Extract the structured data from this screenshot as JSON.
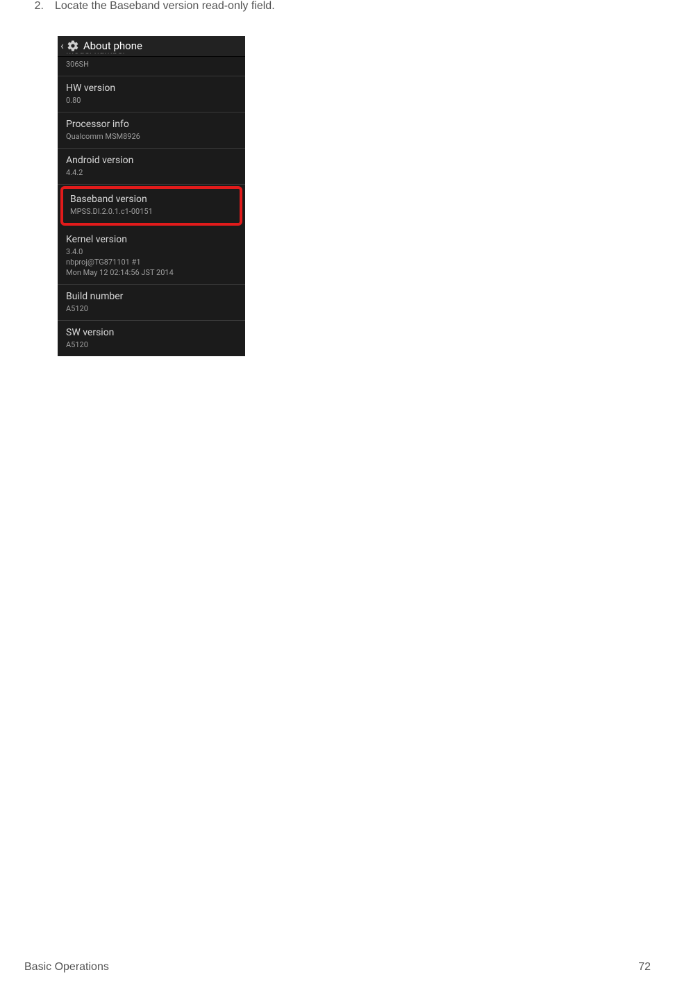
{
  "instruction": {
    "number": "2.",
    "text": "Locate the Baseband version read-only field."
  },
  "phone": {
    "header_title": "About phone",
    "items": {
      "model_number": {
        "label": "Model number",
        "value": "306SH"
      },
      "hw_version": {
        "label": "HW version",
        "value": "0.80"
      },
      "processor_info": {
        "label": "Processor info",
        "value": "Qualcomm MSM8926"
      },
      "android_version": {
        "label": "Android version",
        "value": "4.4.2"
      },
      "baseband_version": {
        "label": "Baseband version",
        "value": "MPSS.DI.2.0.1.c1-00151"
      },
      "kernel_version": {
        "label": "Kernel version",
        "value": "3.4.0\nnbproj@TG871101 #1\nMon May 12 02:14:56 JST 2014"
      },
      "build_number": {
        "label": "Build number",
        "value": "A5120"
      },
      "sw_version": {
        "label": "SW version",
        "value": "A5120"
      }
    }
  },
  "footer": {
    "section": "Basic Operations",
    "page": "72"
  }
}
